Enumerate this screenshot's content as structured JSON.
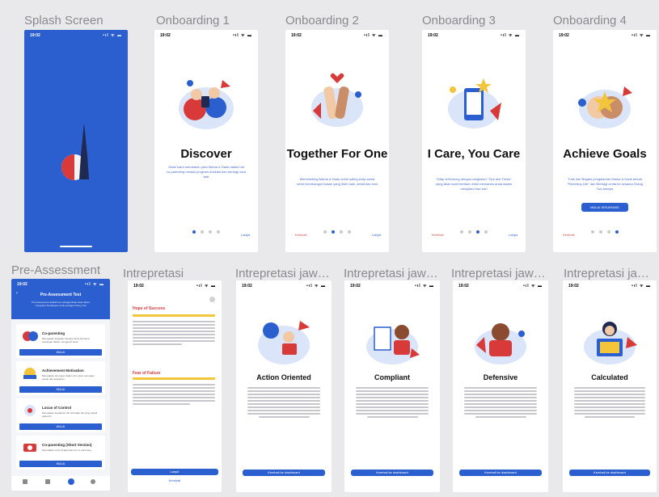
{
  "status": {
    "time": "19:02",
    "icons": "•ıl ᯤ ▬"
  },
  "splash": {
    "title": "Splash Screen"
  },
  "onboarding": [
    {
      "frame": "Onboarding 1",
      "title": "Discover",
      "desc": "Disini kami membantu para Mama & Dads dalam hal co-parenting melalui program edukasi dan berbagi cara asik",
      "right": "Lanjut",
      "left": "",
      "button": ""
    },
    {
      "frame": "Onboarding 2",
      "title": "Together For One",
      "desc": "Membimbing Mama & Dads untuk saling kerja sama demi membangun ikatan yang lebih baik, dekat dan erat",
      "right": "Lanjut",
      "left": "Kembali",
      "button": ""
    },
    {
      "frame": "Onboarding 3",
      "title": "I Care, You Care",
      "desc": "Tetap terhubung dengan rangkaian \"Tips and Tricks\" yang akan kami berikan untuk memandu anda dalam menjalani hari-hari",
      "right": "Lanjut",
      "left": "Kembali",
      "button": ""
    },
    {
      "frame": "Onboarding 4",
      "title": "Achieve Goals",
      "desc": "Tutis dari Bagian pengalaman Mama & Dads terkait \"Parenting Life\" dan Berbagi cerita ke sesama Orang Tua lainnya",
      "right": "",
      "left": "Kembali",
      "button": "MULAI SEKARANG"
    }
  ],
  "pre_assessment": {
    "frame": "Pre-Assessment",
    "header_title": "Pre-Assessment Test",
    "header_sub": "Pre-Assessment adalah tes sebagai tahap awal dalam mengukur Kecakapan anda sebagai Orang Tua",
    "cards": [
      {
        "title": "Co-parenting",
        "sub": "Merupakan kegiatan bekerja sama bersama pasangan dalam mengasuh anak",
        "btn": "MULAI"
      },
      {
        "title": "Achievement Motivation",
        "sub": "Merupakan dorongan dalam diri untuk mencapai tujuan dan keinginan",
        "btn": "MULAI"
      },
      {
        "title": "Locus of Control",
        "sub": "Merupakan keyakinan diri terhadap hal yang terjadi pada diri",
        "btn": "MULAI"
      },
      {
        "title": "Co-parenting (Short Version)",
        "sub": "Merupakan versi singkat dari tes co-parenting",
        "btn": "MULAI"
      }
    ]
  },
  "intrepretasi": {
    "frame": "Intrepretasi",
    "hope": "Hope of Success",
    "fear": "Fear of Failure",
    "button": "Lanjut",
    "back": "Kembali"
  },
  "results": [
    {
      "frame": "Intrepretasi jawaban",
      "title": "Action Oriented",
      "button": "Kembali ke dashboard"
    },
    {
      "frame": "Intrepretasi jawaban",
      "title": "Compliant",
      "button": "Kembali ke dashboard"
    },
    {
      "frame": "Intrepretasi jawaban",
      "title": "Defensive",
      "button": "Kembali ke dashboard"
    },
    {
      "frame": "Intrepretasi jawaban",
      "title": "Calculated",
      "button": "Kembali ke dashboard"
    }
  ],
  "colors": {
    "primary": "#2b5fcf",
    "accent_red": "#d83a3a",
    "yellow": "#f3c53b"
  }
}
